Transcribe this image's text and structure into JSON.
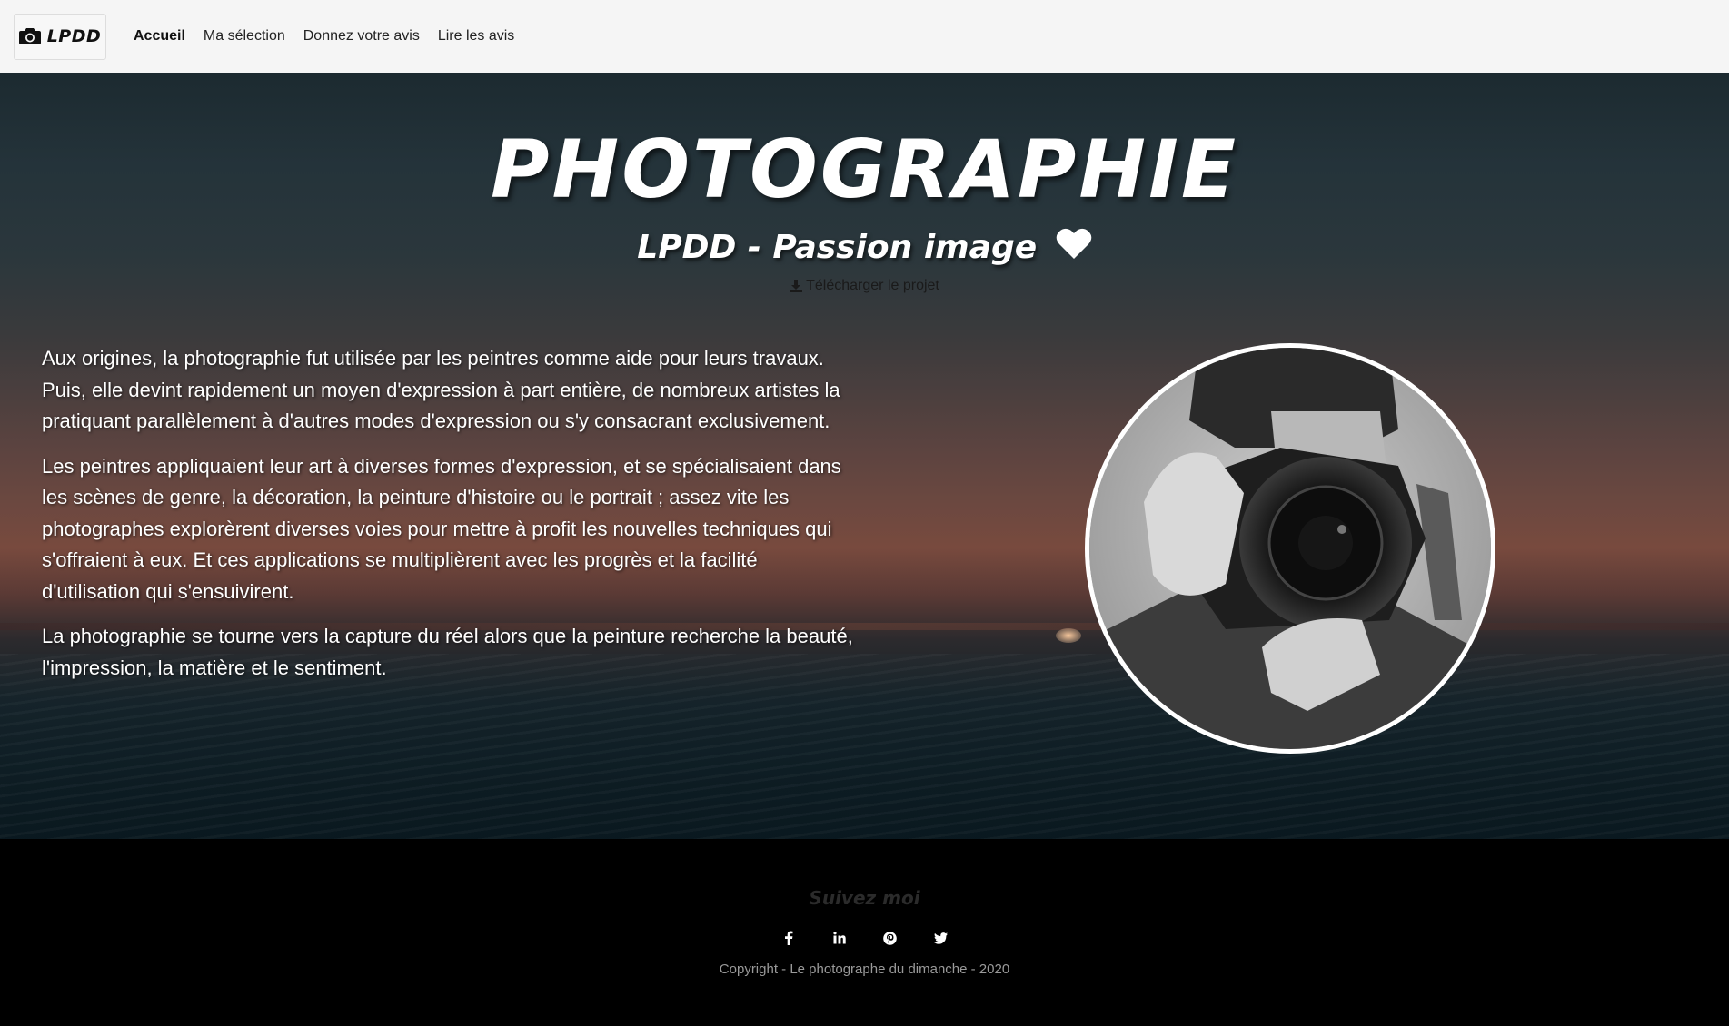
{
  "navbar": {
    "brand_text": "LPDD",
    "brand_icon": "camera-icon",
    "links": [
      {
        "label": "Accueil",
        "active": true
      },
      {
        "label": "Ma sélection",
        "active": false
      },
      {
        "label": "Donnez votre avis",
        "active": false
      },
      {
        "label": "Lire les avis",
        "active": false
      }
    ]
  },
  "hero": {
    "title": "PHOTOGRAPHIE",
    "subtitle": "LPDD - Passion image",
    "subtitle_icon": "heart-icon",
    "download_label": "Télécharger le projet",
    "download_icon": "download-icon",
    "paragraphs": [
      "Aux origines, la photographie fut utilisée par les peintres comme aide pour leurs travaux. Puis, elle devint rapidement un moyen d'expression à part entière, de nombreux artistes la pratiquant parallèlement à d'autres modes d'expression ou s'y consacrant exclusivement.",
      "Les peintres appliquaient leur art à diverses formes d'expression, et se spécialisaient dans les scènes de genre, la décoration, la peinture d'histoire ou le portrait ; assez vite les photographes explorèrent diverses voies pour mettre à profit les nouvelles techniques qui s'offraient à eux. Et ces applications se multiplièrent avec les progrès et la facilité d'utilisation qui s'ensuivirent.",
      "La photographie se tourne vers la capture du réel alors que la peinture recherche la beauté, l'impression, la matière et le sentiment."
    ]
  },
  "footer": {
    "follow_title": "Suivez moi",
    "social_icons": [
      "facebook-icon",
      "linkedin-icon",
      "pinterest-icon",
      "twitter-icon"
    ],
    "copyright": "Copyright - Le photographe du dimanche - 2020"
  },
  "colors": {
    "navbar_bg": "#f5f5f5",
    "footer_bg": "#000000",
    "text_light": "#ffffff",
    "copyright_text": "#9a9a9a"
  }
}
